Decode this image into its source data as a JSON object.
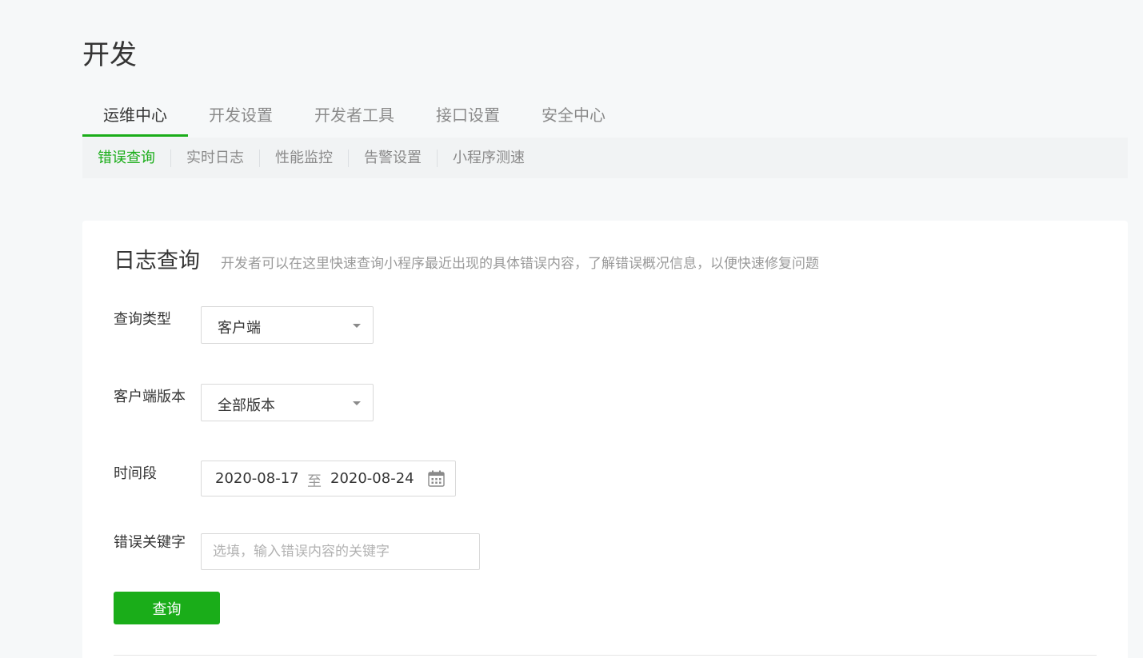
{
  "page": {
    "title": "开发"
  },
  "main_tabs": [
    {
      "label": "运维中心",
      "active": true
    },
    {
      "label": "开发设置",
      "active": false
    },
    {
      "label": "开发者工具",
      "active": false
    },
    {
      "label": "接口设置",
      "active": false
    },
    {
      "label": "安全中心",
      "active": false
    }
  ],
  "sub_tabs": [
    {
      "label": "错误查询",
      "active": true
    },
    {
      "label": "实时日志",
      "active": false
    },
    {
      "label": "性能监控",
      "active": false
    },
    {
      "label": "告警设置",
      "active": false
    },
    {
      "label": "小程序测速",
      "active": false
    }
  ],
  "card": {
    "title": "日志查询",
    "description": "开发者可以在这里快速查询小程序最近出现的具体错误内容，了解错误概况信息，以便快速修复问题"
  },
  "form": {
    "query_type": {
      "label": "查询类型",
      "value": "客户端"
    },
    "client_version": {
      "label": "客户端版本",
      "value": "全部版本"
    },
    "time_range": {
      "label": "时间段",
      "start": "2020-08-17",
      "separator": "至",
      "end": "2020-08-24"
    },
    "keyword": {
      "label": "错误关键字",
      "value": "",
      "placeholder": "选填，输入错误内容的关键字"
    },
    "submit_label": "查询"
  },
  "colors": {
    "accent": "#1aad19",
    "background": "#f6f8f9",
    "card": "#ffffff",
    "text": "#353535",
    "muted": "#8a8a8a"
  },
  "icons": {
    "dropdown": "caret-down-icon",
    "date_picker": "calendar-icon"
  }
}
